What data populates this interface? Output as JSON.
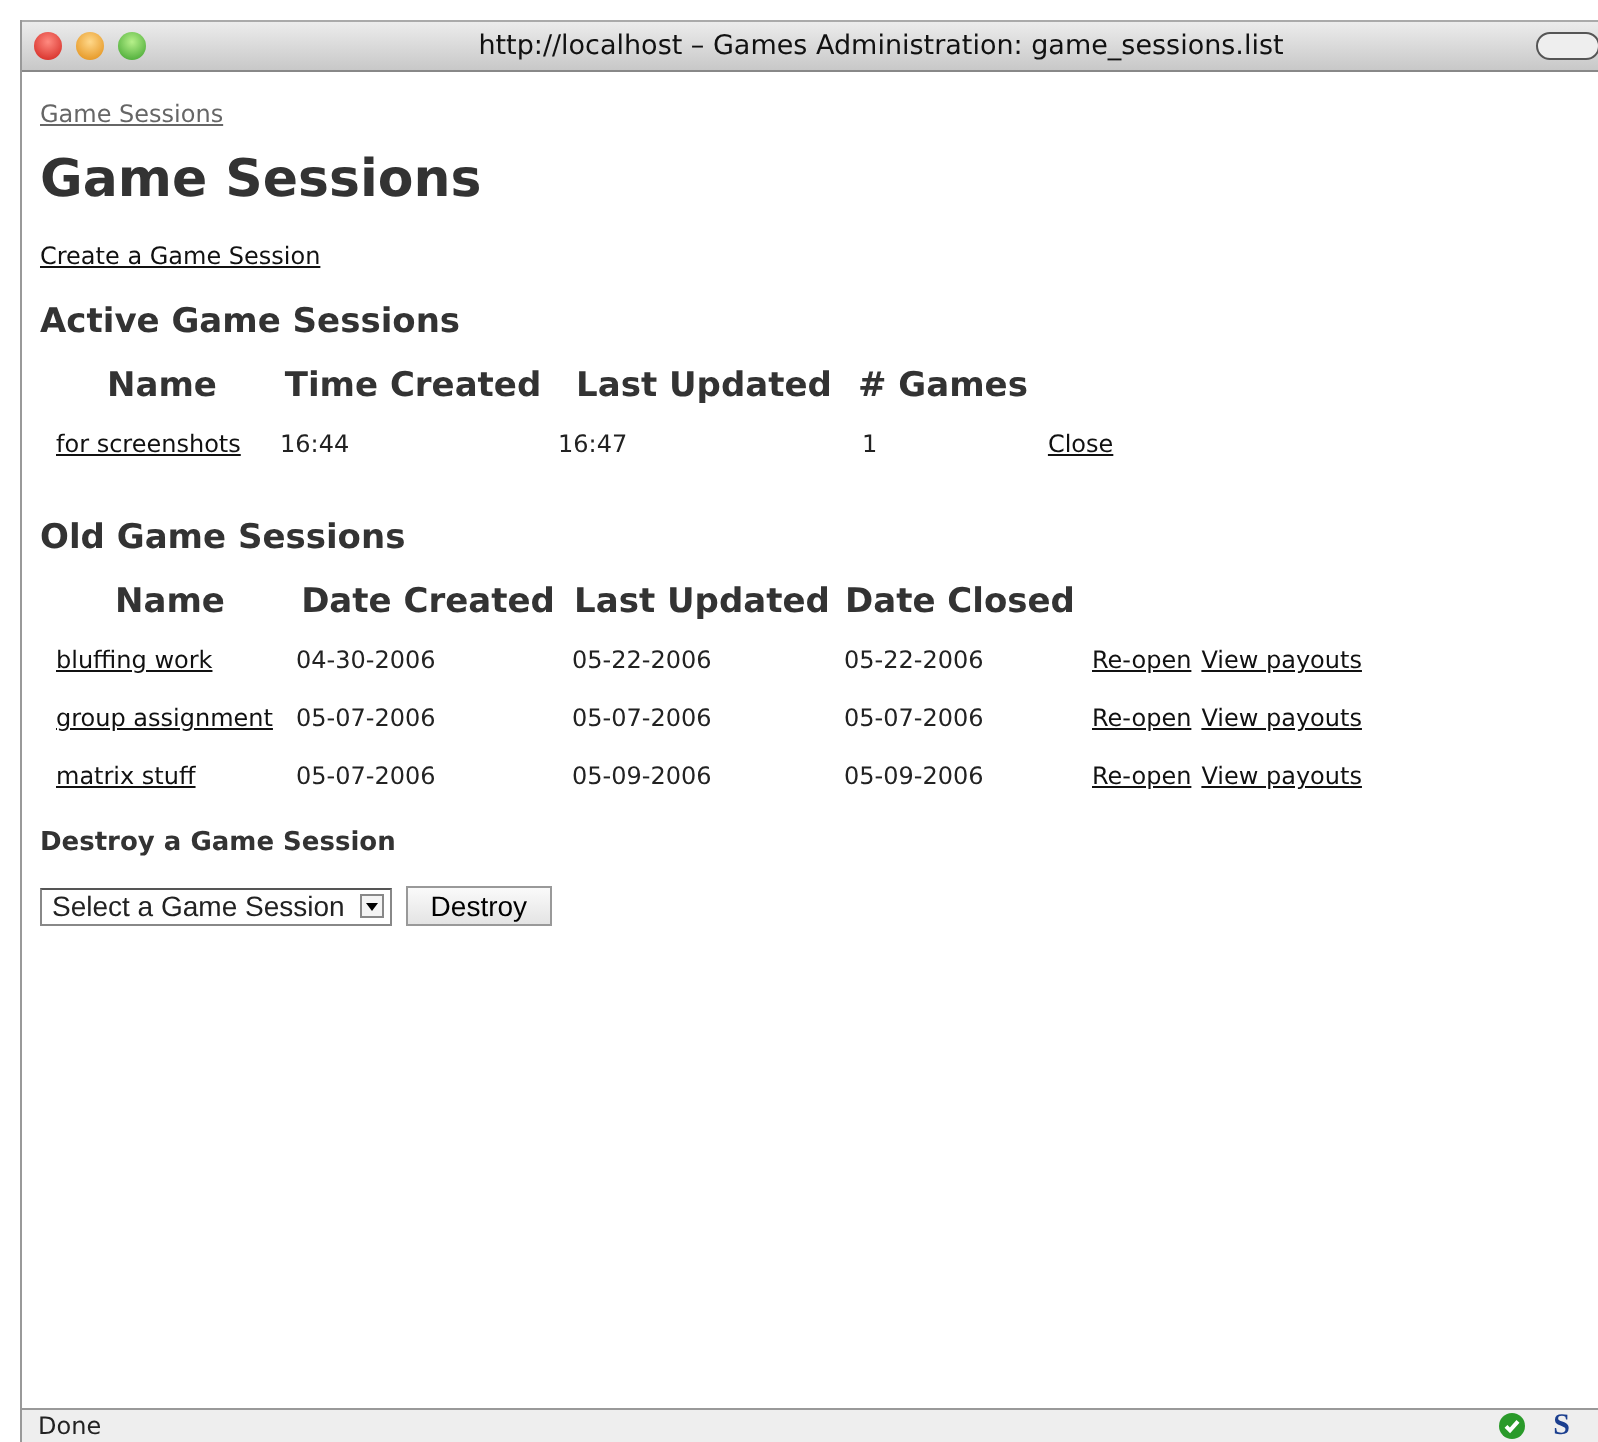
{
  "window": {
    "title": "http://localhost – Games Administration: game_sessions.list"
  },
  "breadcrumb": "Game Sessions",
  "heading": "Game Sessions",
  "create_link": "Create a Game Session",
  "active": {
    "heading": "Active Game Sessions",
    "columns": [
      "Name",
      "Time Created",
      "Last Updated",
      "# Games"
    ],
    "rows": [
      {
        "cells": [
          "for screenshots",
          "16:44",
          "16:47",
          "1"
        ],
        "actions": [
          "Close"
        ]
      }
    ]
  },
  "old": {
    "heading": "Old Game Sessions",
    "columns": [
      "Name",
      "Date Created",
      "Last Updated",
      "Date Closed"
    ],
    "rows": [
      {
        "cells": [
          "bluffing work",
          "04-30-2006",
          "05-22-2006",
          "05-22-2006"
        ],
        "actions": [
          "Re-open",
          "View payouts"
        ]
      },
      {
        "cells": [
          "group assignment",
          "05-07-2006",
          "05-07-2006",
          "05-07-2006"
        ],
        "actions": [
          "Re-open",
          "View payouts"
        ]
      },
      {
        "cells": [
          "matrix stuff",
          "05-07-2006",
          "05-09-2006",
          "05-09-2006"
        ],
        "actions": [
          "Re-open",
          "View payouts"
        ]
      }
    ]
  },
  "destroy": {
    "heading": "Destroy a Game Session",
    "select": "Select a Game Session",
    "button": "Destroy"
  },
  "status_bar": {
    "text": "Done",
    "badge": "S"
  }
}
